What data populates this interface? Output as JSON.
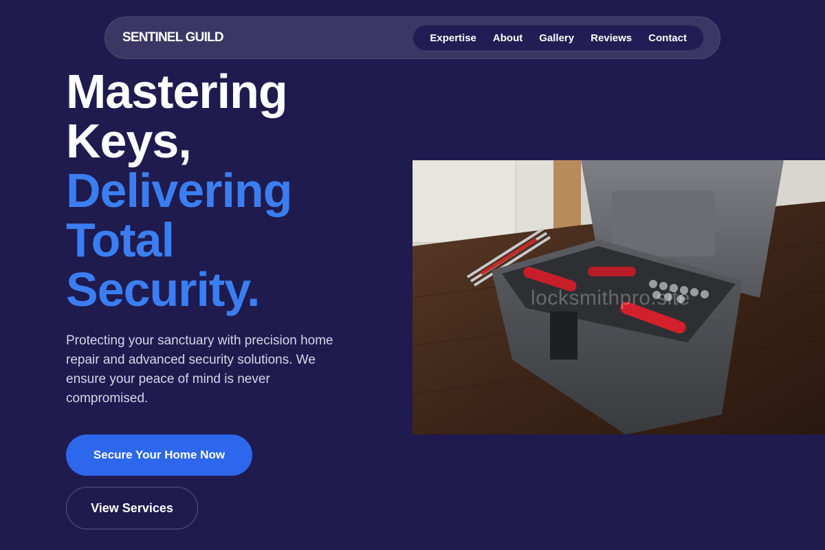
{
  "brand": {
    "name": "SENTINEL GUILD"
  },
  "nav": {
    "items": [
      {
        "label": "Expertise"
      },
      {
        "label": "About"
      },
      {
        "label": "Gallery"
      },
      {
        "label": "Reviews"
      },
      {
        "label": "Contact"
      }
    ]
  },
  "hero": {
    "title_lines_white": [
      "Mastering",
      "Keys,"
    ],
    "title_lines_blue": [
      "Delivering",
      "Total",
      "Security."
    ],
    "description": "Protecting your sanctuary with precision home repair and advanced security solutions. We ensure your peace of mind is never compromised.",
    "primary_cta": "Secure Your Home Now",
    "secondary_cta": "View Services",
    "image_watermark": "locksmithpro.site"
  },
  "colors": {
    "background": "#1f1b4f",
    "accent_blue": "#3b7ef2",
    "button_blue": "#2d67eb"
  }
}
